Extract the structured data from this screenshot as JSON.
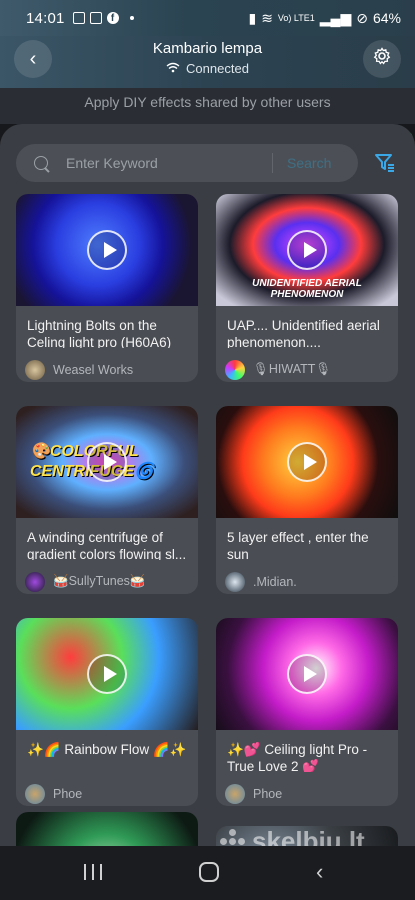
{
  "status_bar": {
    "time": "14:01",
    "signal_text": "Vo) LTE1",
    "battery": "64%"
  },
  "header": {
    "title": "Kambario lempa",
    "connection_status": "Connected"
  },
  "subtitle": "Apply DIY effects shared by other users",
  "search": {
    "placeholder": "Enter Keyword",
    "button_label": "Search"
  },
  "colors": {
    "accent_green": "#2ecc40",
    "filter_blue": "#3aa7e6",
    "panel_bg": "#3a3d43",
    "card_bg": "#4a4d53"
  },
  "cards": [
    {
      "title": "Lightning Bolts on the Celing light pro (H60A6)",
      "author": "Weasel Works",
      "thumb_text": ""
    },
    {
      "title": "UAP.... Unidentified aerial phenomenon....",
      "author": "🎙HIWATT🎙",
      "thumb_text": "UNIDENTIFIED AERIAL PHENOMENON"
    },
    {
      "title": "A winding centrifuge of gradient colors flowing sl...",
      "author": "🥁SullyTunes🥁",
      "thumb_text": "🎨COLORFUL CENTRIFUGE🌀"
    },
    {
      "title": "5 layer effect , enter the sun",
      "author": ".Midian.",
      "thumb_text": ""
    },
    {
      "title": "✨🌈 Rainbow Flow 🌈✨",
      "author": "Phoe",
      "thumb_text": ""
    },
    {
      "title": "✨💕 Ceiling light Pro   - True Love 2 💕",
      "author": "Phoe",
      "thumb_text": ""
    },
    {
      "title": "",
      "author": "",
      "thumb_text": ""
    },
    {
      "title": "",
      "author": "",
      "thumb_text": ""
    }
  ],
  "watermark": "skelbiu.lt"
}
